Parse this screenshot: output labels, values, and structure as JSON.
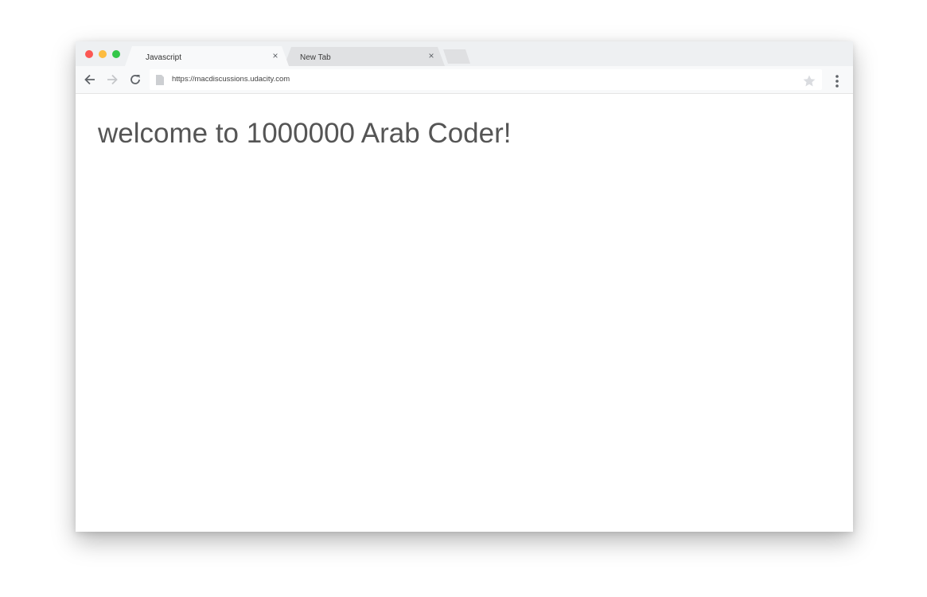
{
  "window_controls": {
    "close_color": "#fc5753",
    "minimize_color": "#fdbc40",
    "zoom_color": "#33c748"
  },
  "tabs": [
    {
      "label": "Javascript",
      "active": true,
      "close_glyph": "×"
    },
    {
      "label": "New Tab",
      "active": false,
      "close_glyph": "×"
    }
  ],
  "toolbar": {
    "back_icon": "arrow-back-icon",
    "forward_icon": "arrow-forward-icon",
    "reload_icon": "reload-icon",
    "url": "https://macdiscussions.udacity.com",
    "bookmark_icon": "star-icon",
    "menu_icon": "kebab-menu-icon"
  },
  "page": {
    "heading": "welcome to 1000000 Arab Coder!"
  },
  "colors": {
    "tabstrip_bg": "#eef0f2",
    "active_tab_bg": "#f8f9fa",
    "inactive_tab_bg": "#e0e1e3",
    "heading_color": "#555555"
  }
}
